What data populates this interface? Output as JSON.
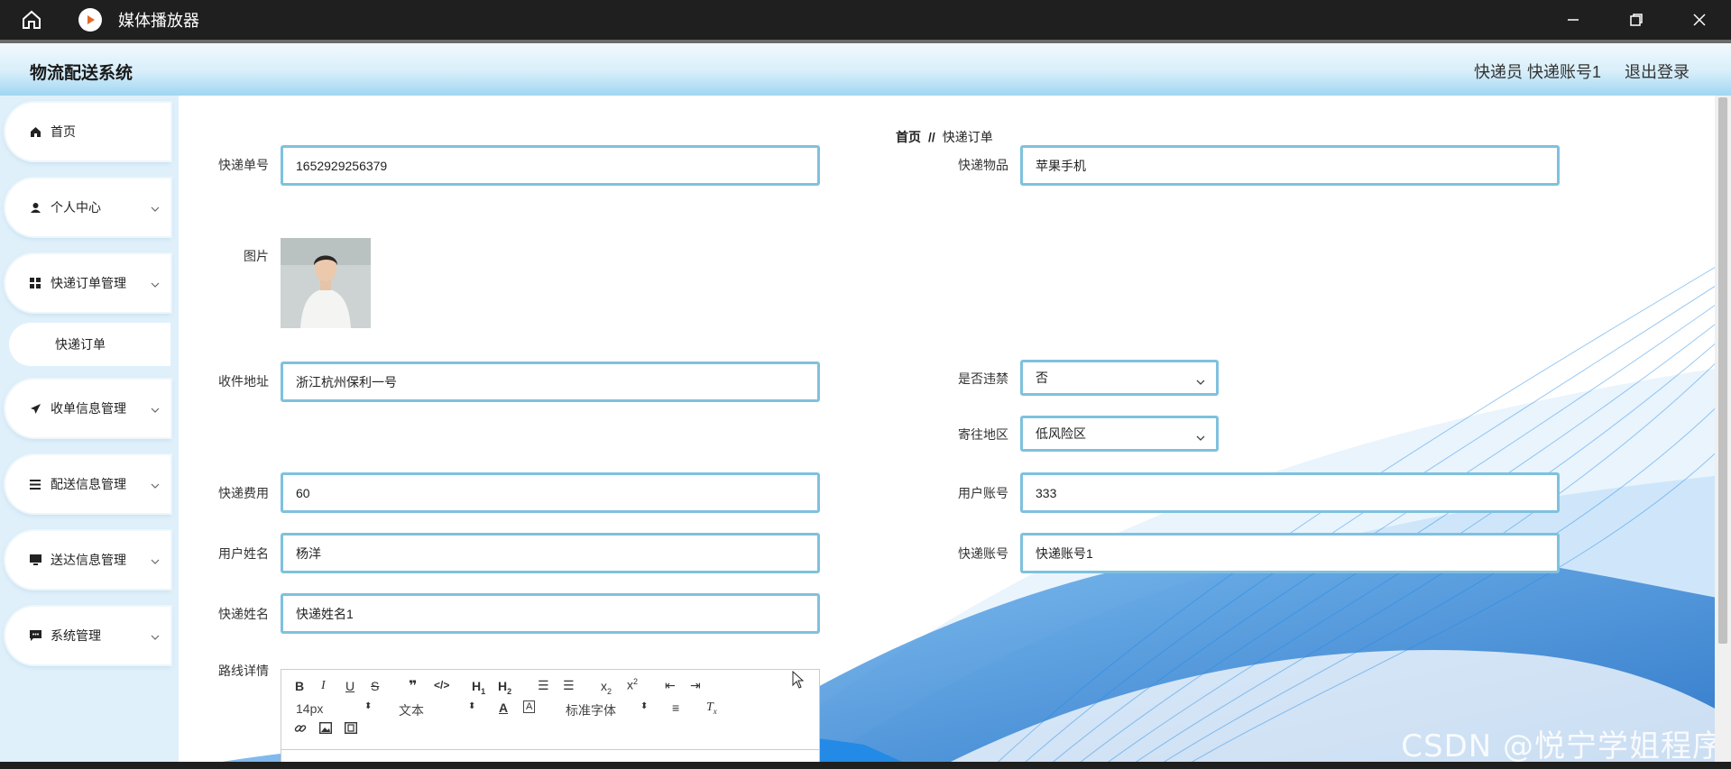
{
  "window": {
    "title": "媒体播放器"
  },
  "header": {
    "brand": "物流配送系统",
    "user": "快递员 快递账号1",
    "logout": "退出登录"
  },
  "sidebar": {
    "items": [
      {
        "label": "首页",
        "icon": "home-icon"
      },
      {
        "label": "个人中心",
        "icon": "user-icon"
      },
      {
        "label": "快递订单管理",
        "icon": "grid-icon"
      },
      {
        "label": "收单信息管理",
        "icon": "send-icon"
      },
      {
        "label": "配送信息管理",
        "icon": "list-icon"
      },
      {
        "label": "送达信息管理",
        "icon": "monitor-icon"
      },
      {
        "label": "系统管理",
        "icon": "chat-icon"
      }
    ],
    "sub_item": "快递订单"
  },
  "breadcrumb": {
    "home": "首页",
    "separator": "//",
    "current": "快递订单"
  },
  "form": {
    "order_no": {
      "label": "快递单号",
      "value": "1652929256379"
    },
    "item": {
      "label": "快递物品",
      "value": "苹果手机"
    },
    "image": {
      "label": "图片"
    },
    "address": {
      "label": "收件地址",
      "value": "浙江杭州保利一号"
    },
    "prohibited": {
      "label": "是否违禁",
      "value": "否"
    },
    "region": {
      "label": "寄往地区",
      "value": "低风险区"
    },
    "fee": {
      "label": "快递费用",
      "value": "60"
    },
    "user_account": {
      "label": "用户账号",
      "value": "333"
    },
    "user_name": {
      "label": "用户姓名",
      "value": "杨洋"
    },
    "courier_account": {
      "label": "快递账号",
      "value": "快递账号1"
    },
    "courier_name": {
      "label": "快递姓名",
      "value": "快递姓名1"
    },
    "route_details": {
      "label": "路线详情"
    }
  },
  "editor": {
    "font_size": "14px",
    "text_type": "文本",
    "font_family": "标准字体"
  },
  "watermark": "CSDN @悦宁学姐程序",
  "colors": {
    "accent": "#7fc1dd",
    "sidebar_bg": "#dff0fa",
    "wave": "#1e88e5"
  }
}
